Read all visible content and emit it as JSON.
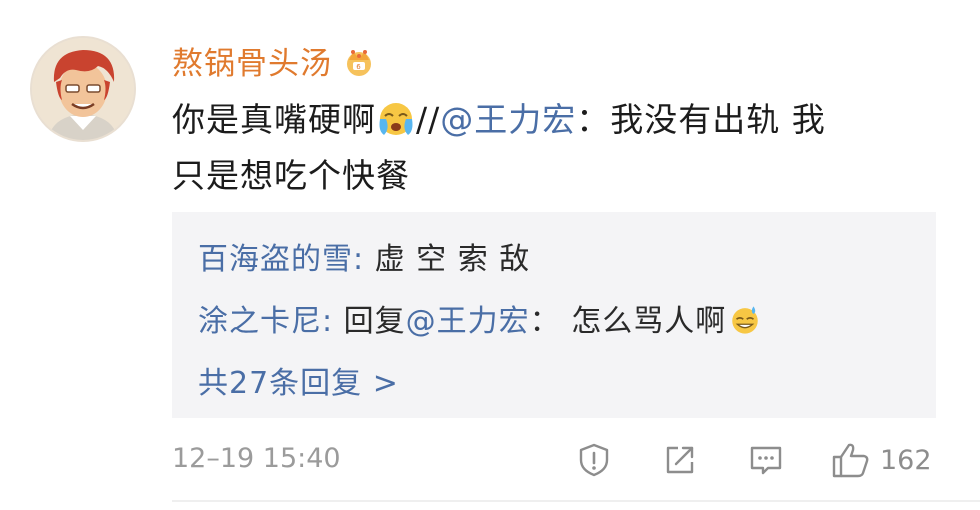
{
  "comment": {
    "username": "熬锅骨头汤",
    "badge_icon": "crown-icon",
    "text_before_emoji": "你是真嘴硬啊",
    "emoji": "crying-face-icon",
    "separator": "//",
    "mention": "@王力宏",
    "text_line1_rest": "：我没有出轨 我",
    "text_line2": "只是想吃个快餐"
  },
  "replies": {
    "items": [
      {
        "author": "百海盗的雪:",
        "text": " 虚 空 索 敌"
      },
      {
        "author": "涂之卡尼:",
        "prefix": " 回复",
        "mention": "@王力宏",
        "text": "： 怎么骂人啊",
        "emoji": "sweat-smile-icon"
      }
    ],
    "more_label": "共27条回复 >"
  },
  "meta": {
    "timestamp": "12–19 15:40",
    "likes": "162"
  },
  "colors": {
    "username": "#e07a2e",
    "link": "#4a6ea6",
    "reply_bg": "#f4f4f6",
    "meta": "#9b9b9b"
  }
}
